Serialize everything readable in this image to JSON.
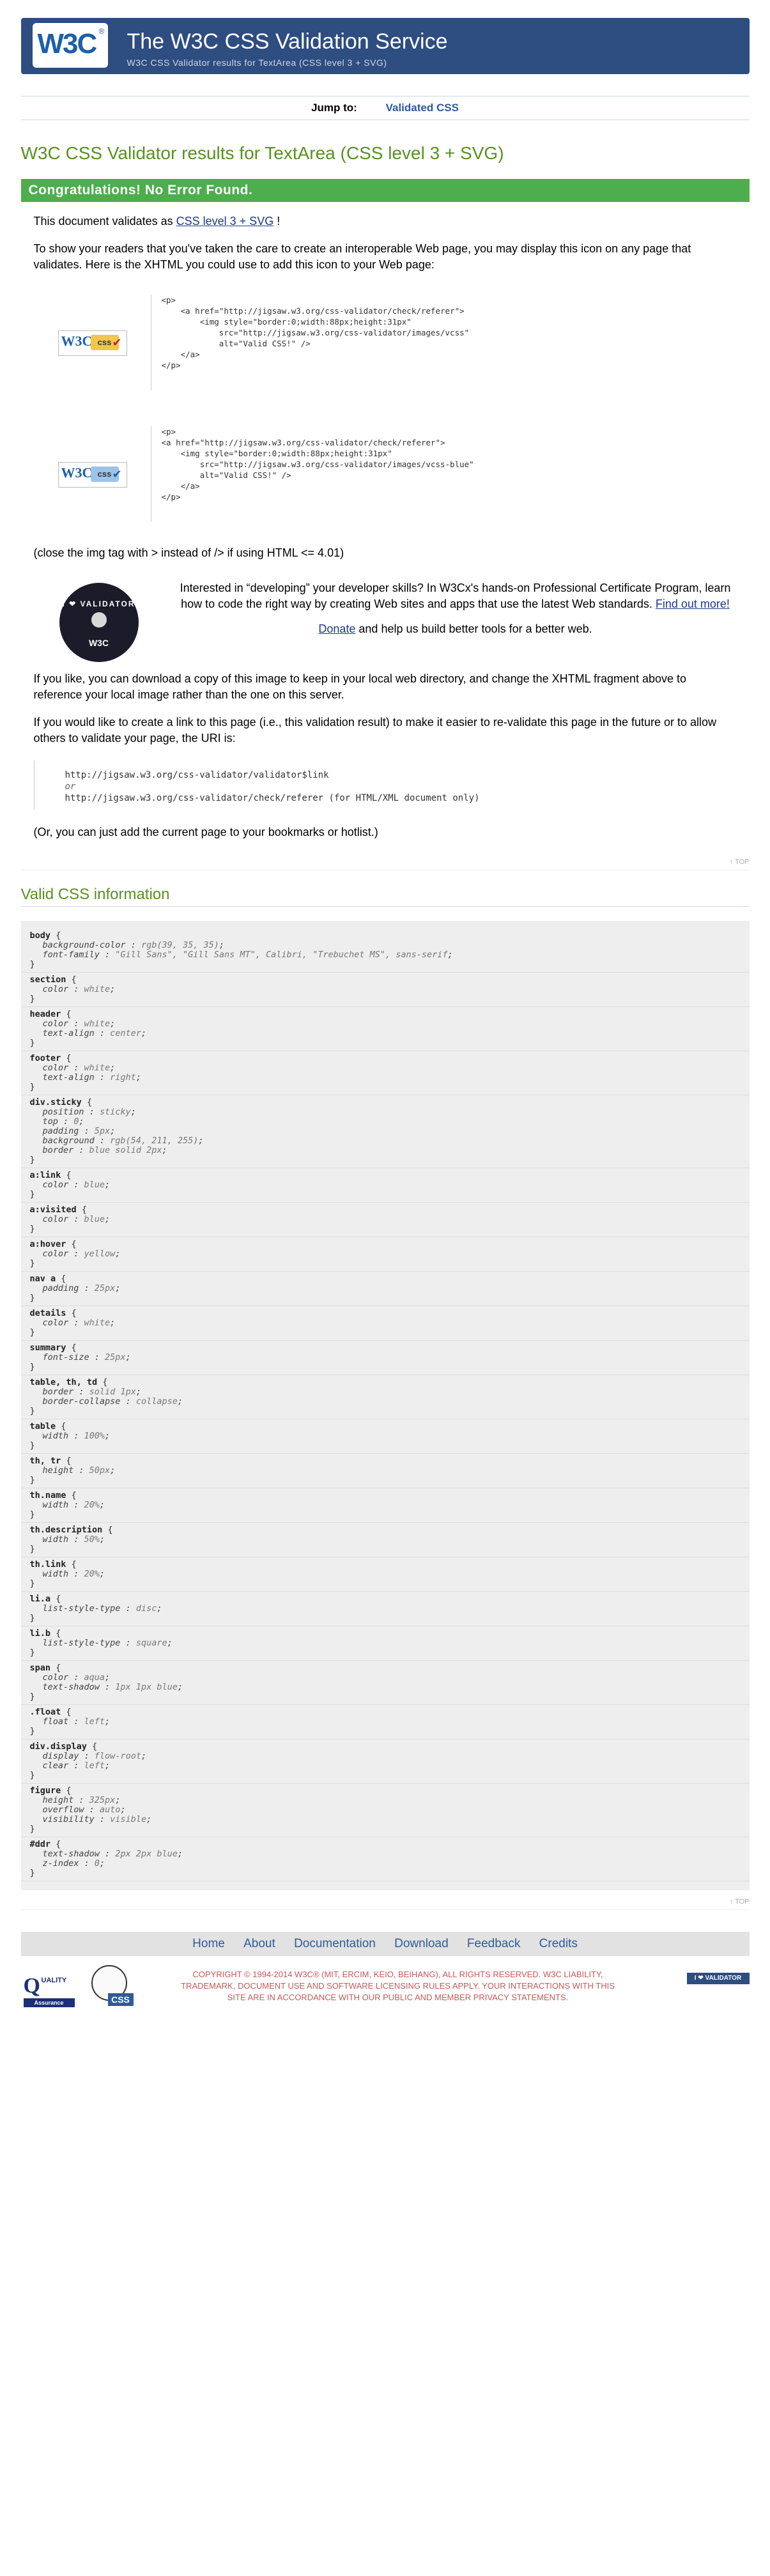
{
  "banner": {
    "logo": "W3C",
    "logo_mark": "®",
    "title": "The W3C CSS Validation Service",
    "subtitle": "W3C CSS Validator results for TextArea (CSS level 3 + SVG)"
  },
  "jump": {
    "label": "Jump to:",
    "link": "Validated CSS"
  },
  "results_title": "W3C CSS Validator results for TextArea (CSS level 3 + SVG)",
  "congrats": "Congratulations! No Error Found.",
  "validates": {
    "pre": "This document validates as ",
    "link": "CSS level 3 + SVG",
    "post": " !"
  },
  "show_readers": "To show your readers that you've taken the care to create an interoperable Web page, you may display this icon on any page that validates. Here is the XHTML you could use to add this icon to your Web page:",
  "badge1": {
    "w3c": "W3C",
    "css": "css",
    "check": "✔",
    "code": "<p>\n    <a href=\"http://jigsaw.w3.org/css-validator/check/referer\">\n        <img style=\"border:0;width:88px;height:31px\"\n            src=\"http://jigsaw.w3.org/css-validator/images/vcss\"\n            alt=\"Valid CSS!\" />\n    </a>\n</p>"
  },
  "badge2": {
    "w3c": "W3C",
    "css": "css",
    "check": "✔",
    "code": "<p>\n<a href=\"http://jigsaw.w3.org/css-validator/check/referer\">\n    <img style=\"border:0;width:88px;height:31px\"\n        src=\"http://jigsaw.w3.org/css-validator/images/vcss-blue\"\n        alt=\"Valid CSS!\" />\n    </a>\n</p>"
  },
  "close_img": "(close the img tag with > instead of /> if using HTML <= 4.01)",
  "promo": {
    "badge_top": "I ❤ VALIDATOR",
    "badge_bottom": "W3C",
    "text": "Interested in “developing” your developer skills? In W3Cx's hands-on Professional Certificate Program, learn how to code the right way by creating Web sites and apps that use the latest Web standards.",
    "find_more": "Find out more!",
    "donate": "Donate",
    "donate_post": " and help us build better tools for a better web."
  },
  "download_copy": "If you like, you can download a copy of this image to keep in your local web directory, and change the XHTML fragment above to reference your local image rather than the one on this server.",
  "create_link": "If you would like to create a link to this page (i.e., this validation result) to make it easier to re-validate this page in the future or to allow others to validate your page, the URI is:",
  "uri1": "http://jigsaw.w3.org/css-validator/validator$link",
  "uri_or": "or",
  "uri2": "http://jigsaw.w3.org/css-validator/check/referer (for HTML/XML document only)",
  "bookmark": "(Or, you can just add the current page to your bookmarks or hotlist.)",
  "top_label": "↑ TOP",
  "valid_title": "Valid CSS information",
  "rules": [
    {
      "sel": "body",
      "decls": [
        [
          "background-color",
          "rgb(39, 35, 35)"
        ],
        [
          "font-family",
          "\"Gill Sans\", \"Gill Sans MT\", Calibri, \"Trebuchet MS\", sans-serif"
        ]
      ]
    },
    {
      "sel": "section",
      "decls": [
        [
          "color",
          "white"
        ]
      ]
    },
    {
      "sel": "header",
      "decls": [
        [
          "color",
          "white"
        ],
        [
          "text-align",
          "center"
        ]
      ]
    },
    {
      "sel": "footer",
      "decls": [
        [
          "color",
          "white"
        ],
        [
          "text-align",
          "right"
        ]
      ]
    },
    {
      "sel": "div.sticky",
      "decls": [
        [
          "position",
          "sticky"
        ],
        [
          "top",
          "0"
        ],
        [
          "padding",
          "5px"
        ],
        [
          "background",
          "rgb(54, 211, 255)"
        ],
        [
          "border",
          "blue solid 2px"
        ]
      ]
    },
    {
      "sel": "a:link",
      "decls": [
        [
          "color",
          "blue"
        ]
      ]
    },
    {
      "sel": "a:visited",
      "decls": [
        [
          "color",
          "blue"
        ]
      ]
    },
    {
      "sel": "a:hover",
      "decls": [
        [
          "color",
          "yellow"
        ]
      ]
    },
    {
      "sel": "nav a",
      "decls": [
        [
          "padding",
          "25px"
        ]
      ]
    },
    {
      "sel": "details",
      "decls": [
        [
          "color",
          "white"
        ]
      ]
    },
    {
      "sel": "summary",
      "decls": [
        [
          "font-size",
          "25px"
        ]
      ]
    },
    {
      "sel": "table, th, td",
      "decls": [
        [
          "border",
          "solid 1px"
        ],
        [
          "border-collapse",
          "collapse"
        ]
      ]
    },
    {
      "sel": "table",
      "decls": [
        [
          "width",
          "100%"
        ]
      ]
    },
    {
      "sel": "th, tr",
      "decls": [
        [
          "height",
          "50px"
        ]
      ]
    },
    {
      "sel": "th.name",
      "decls": [
        [
          "width",
          "20%"
        ]
      ]
    },
    {
      "sel": "th.description",
      "decls": [
        [
          "width",
          "50%"
        ]
      ]
    },
    {
      "sel": "th.link",
      "decls": [
        [
          "width",
          "20%"
        ]
      ]
    },
    {
      "sel": "li.a",
      "decls": [
        [
          "list-style-type",
          "disc"
        ]
      ]
    },
    {
      "sel": "li.b",
      "decls": [
        [
          "list-style-type",
          "square"
        ]
      ]
    },
    {
      "sel": "span",
      "decls": [
        [
          "color",
          "aqua"
        ],
        [
          "text-shadow",
          "1px 1px blue"
        ]
      ]
    },
    {
      "sel": ".float",
      "decls": [
        [
          "float",
          "left"
        ]
      ]
    },
    {
      "sel": "div.display",
      "decls": [
        [
          "display",
          "flow-root"
        ],
        [
          "clear",
          "left"
        ]
      ]
    },
    {
      "sel": "figure",
      "decls": [
        [
          "height",
          "325px"
        ],
        [
          "overflow",
          "auto"
        ],
        [
          "visibility",
          "visible"
        ]
      ]
    },
    {
      "sel": "#ddr",
      "decls": [
        [
          "text-shadow",
          "2px 2px blue"
        ],
        [
          "z-index",
          "0"
        ]
      ]
    }
  ],
  "footnav": [
    "Home",
    "About",
    "Documentation",
    "Download",
    "Feedback",
    "Credits"
  ],
  "footer": {
    "qa_letter": "Q",
    "qa_text": "UALITY",
    "qa_bar": "Assurance",
    "css_logo": "CSS",
    "copyright": "COPYRIGHT © 1994-2014 W3C® (MIT, ERCIM, KEIO, BEIHANG), ALL RIGHTS RESERVED. W3C LIABILITY, TRADEMARK, DOCUMENT USE AND SOFTWARE LICENSING RULES APPLY. YOUR INTERACTIONS WITH THIS SITE ARE IN ACCORDANCE WITH OUR PUBLIC AND MEMBER PRIVACY STATEMENTS.",
    "badge": "I ❤ VALIDATOR"
  },
  "colors": {
    "banner": "#2e4d80",
    "green": "#58911f",
    "congrats": "#4cae4c",
    "link": "#1a3a8c",
    "footer_text": "#c45a57"
  }
}
